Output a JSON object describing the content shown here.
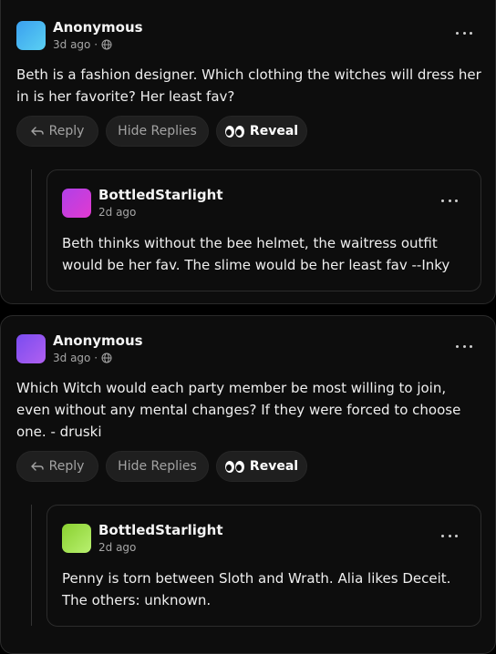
{
  "colors": {
    "avatar1": [
      "#3aa0f0",
      "#5ad0f2"
    ],
    "avatar2": [
      "#b040e8",
      "#e13ad0"
    ],
    "avatar3": [
      "#7a4cf0",
      "#b060f0"
    ],
    "avatar4": [
      "#8ad030",
      "#b8f070"
    ]
  },
  "posts": [
    {
      "author": "Anonymous",
      "age": "3d ago ·",
      "text": "Beth is a fashion designer. Which clothing the witches will dress her in is her favorite? Her least fav?",
      "reply_label": "Reply",
      "hide_label": "Hide Replies",
      "reveal_label": "Reveal",
      "reply": {
        "author": "BottledStarlight",
        "age": "2d ago",
        "text": "Beth thinks without the bee helmet, the waitress outfit would be her fav. The slime would be her least fav --Inky"
      }
    },
    {
      "author": "Anonymous",
      "age": "3d ago ·",
      "text": "Which Witch would each party member be most willing to join, even without any mental changes? If they were forced to choose one. - druski",
      "reply_label": "Reply",
      "hide_label": "Hide Replies",
      "reveal_label": "Reveal",
      "reply": {
        "author": "BottledStarlight",
        "age": "2d ago",
        "text": "Penny is torn between Sloth and Wrath. Alia likes Deceit. The others: unknown."
      }
    }
  ]
}
